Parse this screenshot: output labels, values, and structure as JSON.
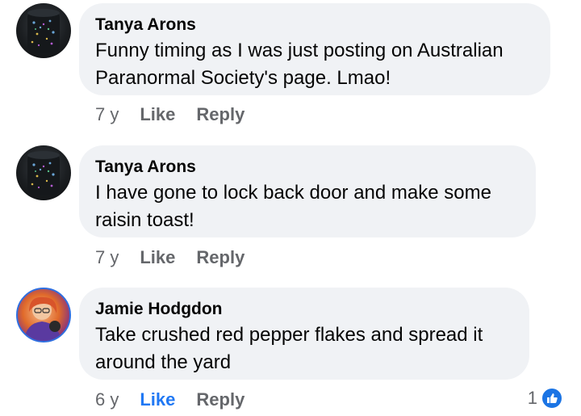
{
  "comments": [
    {
      "author": "Tanya Arons",
      "text_lines": [
        "Funny timing as I was just posting on Australian",
        "Paranormal Society's page.  Lmao!"
      ],
      "time": "7 y",
      "like": "Like",
      "reply": "Reply",
      "like_active": false
    },
    {
      "author": "Tanya Arons",
      "text_lines": [
        "I have gone to lock back door and make some",
        "raisin toast!"
      ],
      "time": "7 y",
      "like": "Like",
      "reply": "Reply",
      "like_active": false
    },
    {
      "author": "Jamie Hodgdon",
      "text_lines": [
        "Take crushed red pepper flakes and spread it",
        "around the yard"
      ],
      "time": "6 y",
      "like": "Like",
      "reply": "Reply",
      "like_active": true,
      "reaction_count": "1"
    }
  ],
  "colors": {
    "bubble": "#f0f2f5",
    "secondary_text": "#65676b",
    "like_active": "#2078f4",
    "reaction_blue": "#1b74e4"
  }
}
